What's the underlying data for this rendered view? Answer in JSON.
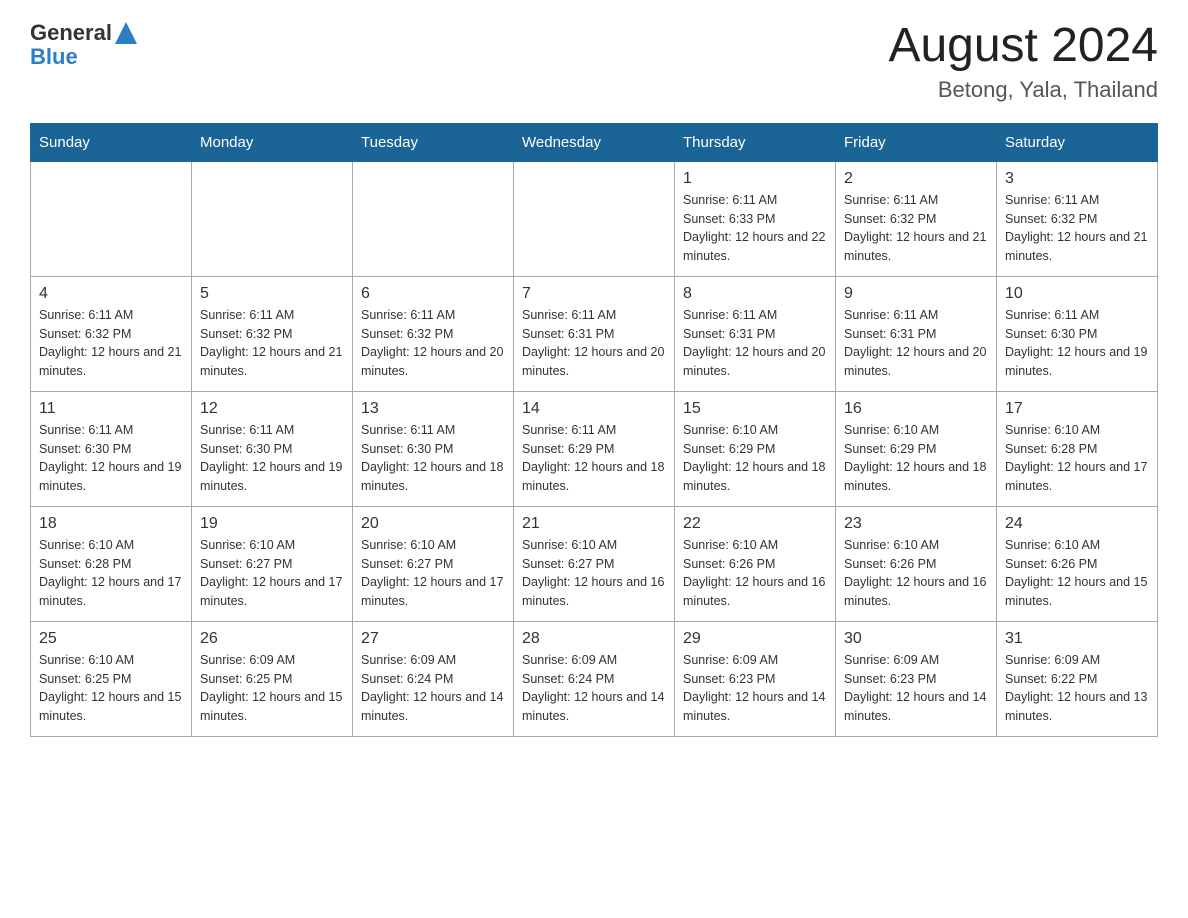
{
  "header": {
    "logo": {
      "general": "General",
      "triangle": "▶",
      "blue": "Blue"
    },
    "month_title": "August 2024",
    "location": "Betong, Yala, Thailand"
  },
  "weekdays": [
    "Sunday",
    "Monday",
    "Tuesday",
    "Wednesday",
    "Thursday",
    "Friday",
    "Saturday"
  ],
  "weeks": [
    [
      {
        "day": "",
        "sunrise": "",
        "sunset": "",
        "daylight": ""
      },
      {
        "day": "",
        "sunrise": "",
        "sunset": "",
        "daylight": ""
      },
      {
        "day": "",
        "sunrise": "",
        "sunset": "",
        "daylight": ""
      },
      {
        "day": "",
        "sunrise": "",
        "sunset": "",
        "daylight": ""
      },
      {
        "day": "1",
        "sunrise": "Sunrise: 6:11 AM",
        "sunset": "Sunset: 6:33 PM",
        "daylight": "Daylight: 12 hours and 22 minutes."
      },
      {
        "day": "2",
        "sunrise": "Sunrise: 6:11 AM",
        "sunset": "Sunset: 6:32 PM",
        "daylight": "Daylight: 12 hours and 21 minutes."
      },
      {
        "day": "3",
        "sunrise": "Sunrise: 6:11 AM",
        "sunset": "Sunset: 6:32 PM",
        "daylight": "Daylight: 12 hours and 21 minutes."
      }
    ],
    [
      {
        "day": "4",
        "sunrise": "Sunrise: 6:11 AM",
        "sunset": "Sunset: 6:32 PM",
        "daylight": "Daylight: 12 hours and 21 minutes."
      },
      {
        "day": "5",
        "sunrise": "Sunrise: 6:11 AM",
        "sunset": "Sunset: 6:32 PM",
        "daylight": "Daylight: 12 hours and 21 minutes."
      },
      {
        "day": "6",
        "sunrise": "Sunrise: 6:11 AM",
        "sunset": "Sunset: 6:32 PM",
        "daylight": "Daylight: 12 hours and 20 minutes."
      },
      {
        "day": "7",
        "sunrise": "Sunrise: 6:11 AM",
        "sunset": "Sunset: 6:31 PM",
        "daylight": "Daylight: 12 hours and 20 minutes."
      },
      {
        "day": "8",
        "sunrise": "Sunrise: 6:11 AM",
        "sunset": "Sunset: 6:31 PM",
        "daylight": "Daylight: 12 hours and 20 minutes."
      },
      {
        "day": "9",
        "sunrise": "Sunrise: 6:11 AM",
        "sunset": "Sunset: 6:31 PM",
        "daylight": "Daylight: 12 hours and 20 minutes."
      },
      {
        "day": "10",
        "sunrise": "Sunrise: 6:11 AM",
        "sunset": "Sunset: 6:30 PM",
        "daylight": "Daylight: 12 hours and 19 minutes."
      }
    ],
    [
      {
        "day": "11",
        "sunrise": "Sunrise: 6:11 AM",
        "sunset": "Sunset: 6:30 PM",
        "daylight": "Daylight: 12 hours and 19 minutes."
      },
      {
        "day": "12",
        "sunrise": "Sunrise: 6:11 AM",
        "sunset": "Sunset: 6:30 PM",
        "daylight": "Daylight: 12 hours and 19 minutes."
      },
      {
        "day": "13",
        "sunrise": "Sunrise: 6:11 AM",
        "sunset": "Sunset: 6:30 PM",
        "daylight": "Daylight: 12 hours and 18 minutes."
      },
      {
        "day": "14",
        "sunrise": "Sunrise: 6:11 AM",
        "sunset": "Sunset: 6:29 PM",
        "daylight": "Daylight: 12 hours and 18 minutes."
      },
      {
        "day": "15",
        "sunrise": "Sunrise: 6:10 AM",
        "sunset": "Sunset: 6:29 PM",
        "daylight": "Daylight: 12 hours and 18 minutes."
      },
      {
        "day": "16",
        "sunrise": "Sunrise: 6:10 AM",
        "sunset": "Sunset: 6:29 PM",
        "daylight": "Daylight: 12 hours and 18 minutes."
      },
      {
        "day": "17",
        "sunrise": "Sunrise: 6:10 AM",
        "sunset": "Sunset: 6:28 PM",
        "daylight": "Daylight: 12 hours and 17 minutes."
      }
    ],
    [
      {
        "day": "18",
        "sunrise": "Sunrise: 6:10 AM",
        "sunset": "Sunset: 6:28 PM",
        "daylight": "Daylight: 12 hours and 17 minutes."
      },
      {
        "day": "19",
        "sunrise": "Sunrise: 6:10 AM",
        "sunset": "Sunset: 6:27 PM",
        "daylight": "Daylight: 12 hours and 17 minutes."
      },
      {
        "day": "20",
        "sunrise": "Sunrise: 6:10 AM",
        "sunset": "Sunset: 6:27 PM",
        "daylight": "Daylight: 12 hours and 17 minutes."
      },
      {
        "day": "21",
        "sunrise": "Sunrise: 6:10 AM",
        "sunset": "Sunset: 6:27 PM",
        "daylight": "Daylight: 12 hours and 16 minutes."
      },
      {
        "day": "22",
        "sunrise": "Sunrise: 6:10 AM",
        "sunset": "Sunset: 6:26 PM",
        "daylight": "Daylight: 12 hours and 16 minutes."
      },
      {
        "day": "23",
        "sunrise": "Sunrise: 6:10 AM",
        "sunset": "Sunset: 6:26 PM",
        "daylight": "Daylight: 12 hours and 16 minutes."
      },
      {
        "day": "24",
        "sunrise": "Sunrise: 6:10 AM",
        "sunset": "Sunset: 6:26 PM",
        "daylight": "Daylight: 12 hours and 15 minutes."
      }
    ],
    [
      {
        "day": "25",
        "sunrise": "Sunrise: 6:10 AM",
        "sunset": "Sunset: 6:25 PM",
        "daylight": "Daylight: 12 hours and 15 minutes."
      },
      {
        "day": "26",
        "sunrise": "Sunrise: 6:09 AM",
        "sunset": "Sunset: 6:25 PM",
        "daylight": "Daylight: 12 hours and 15 minutes."
      },
      {
        "day": "27",
        "sunrise": "Sunrise: 6:09 AM",
        "sunset": "Sunset: 6:24 PM",
        "daylight": "Daylight: 12 hours and 14 minutes."
      },
      {
        "day": "28",
        "sunrise": "Sunrise: 6:09 AM",
        "sunset": "Sunset: 6:24 PM",
        "daylight": "Daylight: 12 hours and 14 minutes."
      },
      {
        "day": "29",
        "sunrise": "Sunrise: 6:09 AM",
        "sunset": "Sunset: 6:23 PM",
        "daylight": "Daylight: 12 hours and 14 minutes."
      },
      {
        "day": "30",
        "sunrise": "Sunrise: 6:09 AM",
        "sunset": "Sunset: 6:23 PM",
        "daylight": "Daylight: 12 hours and 14 minutes."
      },
      {
        "day": "31",
        "sunrise": "Sunrise: 6:09 AM",
        "sunset": "Sunset: 6:22 PM",
        "daylight": "Daylight: 12 hours and 13 minutes."
      }
    ]
  ]
}
